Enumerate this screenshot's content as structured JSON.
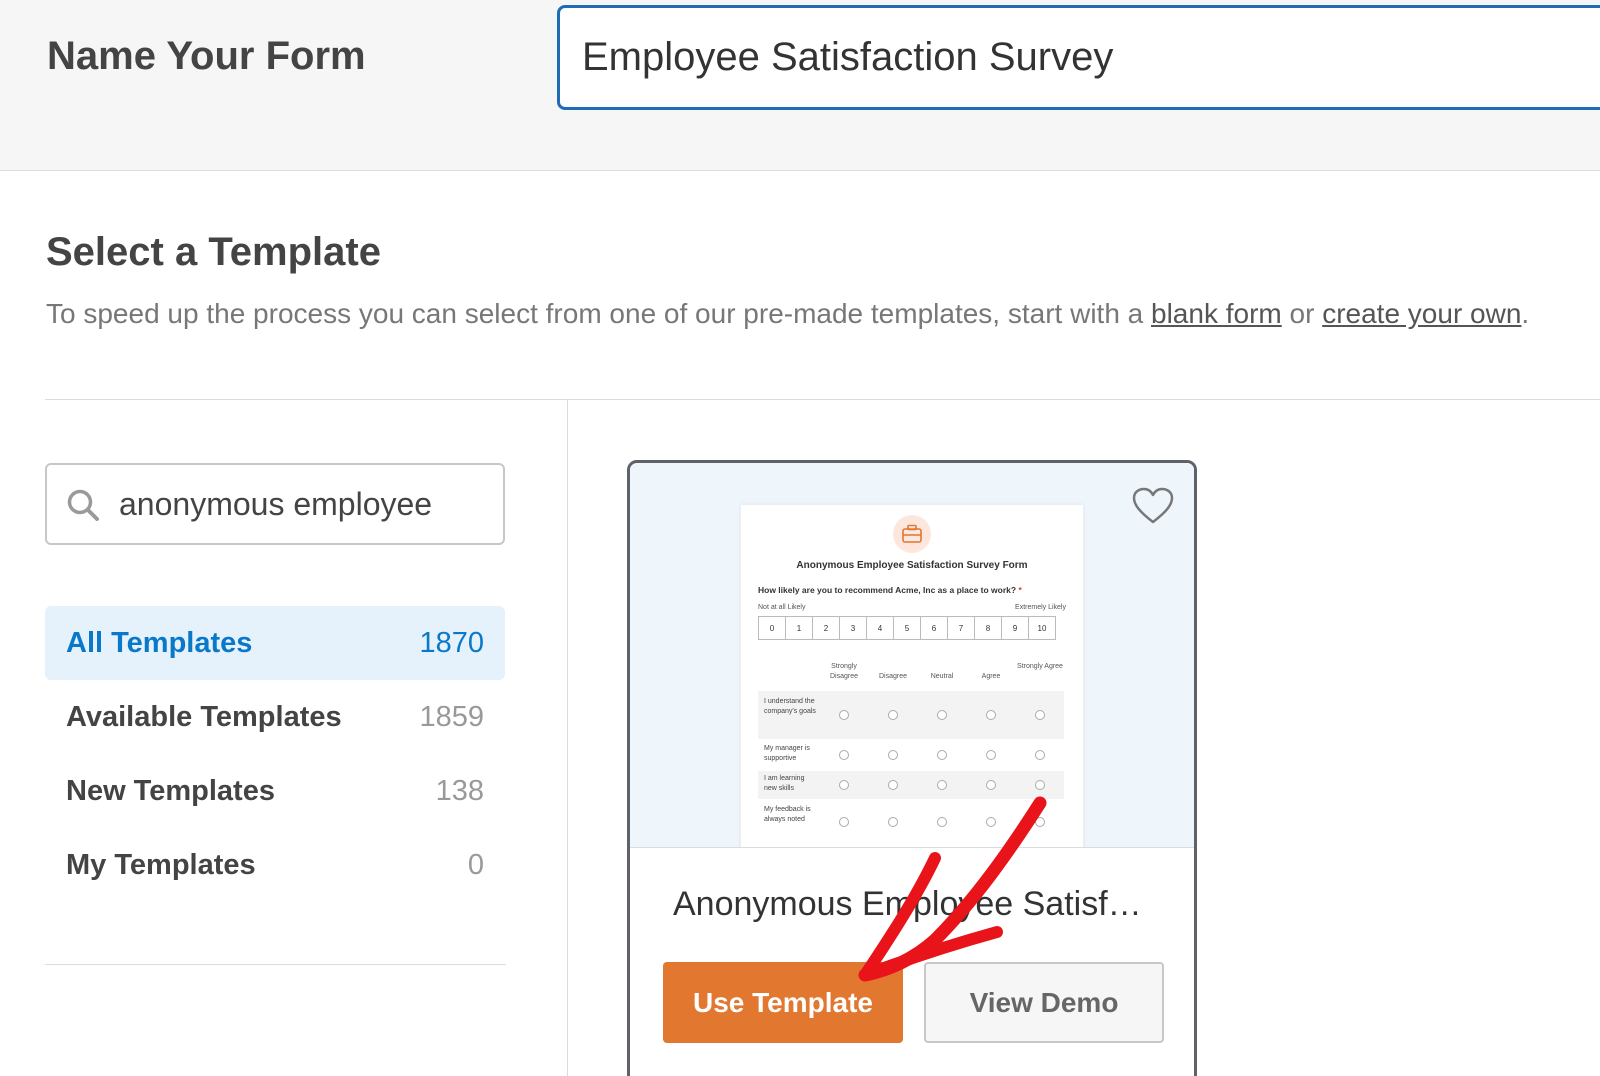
{
  "header": {
    "label": "Name Your Form",
    "form_name_value": "Employee Satisfaction Survey"
  },
  "section": {
    "title": "Select a Template",
    "desc_prefix": "To speed up the process you can select from one of our pre-made templates, start with a ",
    "blank_form_link": "blank form",
    "desc_middle": " or ",
    "create_own_link": "create your own",
    "desc_suffix": "."
  },
  "search": {
    "value": "anonymous employee",
    "icon": "search-icon"
  },
  "categories": [
    {
      "label": "All Templates",
      "count": "1870",
      "active": true
    },
    {
      "label": "Available Templates",
      "count": "1859",
      "active": false
    },
    {
      "label": "New Templates",
      "count": "138",
      "active": false
    },
    {
      "label": "My Templates",
      "count": "0",
      "active": false
    }
  ],
  "card": {
    "title": "Anonymous Employee Satisfa...",
    "use_button": "Use Template",
    "demo_button": "View Demo",
    "favorite_icon": "heart-icon",
    "preview": {
      "title": "Anonymous Employee Satisfaction Survey Form",
      "question": "How likely are you to recommend Acme, Inc as a place to work?",
      "required_mark": "*",
      "scale_low": "Not at all Likely",
      "scale_high": "Extremely Likely",
      "scale": [
        "0",
        "1",
        "2",
        "3",
        "4",
        "5",
        "6",
        "7",
        "8",
        "9",
        "10"
      ],
      "columns": [
        "Strongly Disagree",
        "Disagree",
        "Neutral",
        "Agree",
        "Strongly Agree"
      ],
      "rows": [
        "I understand the company's goals",
        "My manager is supportive",
        "I am learning new skills",
        "My feedback is always noted"
      ]
    }
  },
  "colors": {
    "accent_blue": "#0a78c9",
    "input_border": "#1e6cb3",
    "use_button": "#e27730",
    "annotation_arrow": "#e8141a"
  }
}
